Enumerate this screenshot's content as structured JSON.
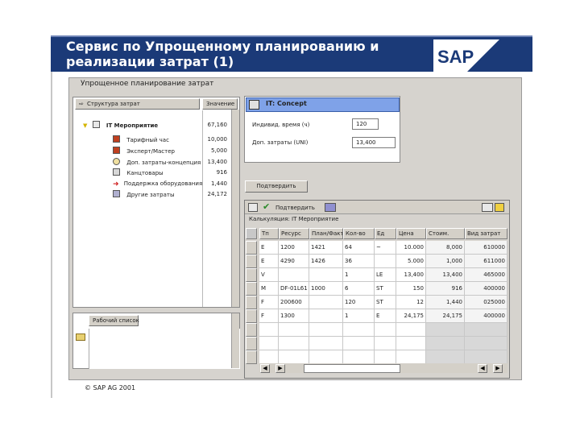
{
  "slide": {
    "title_line1": "Сервис по Упрощенному планированию и",
    "title_line2": "реализации затрат   (1)",
    "footer": "SAP AG 2001",
    "logo_text": "SAP"
  },
  "window": {
    "title": "Упрощенное планирование затрат"
  },
  "left_panel": {
    "structure_header": "Структура затрат",
    "value_header": "Значение",
    "root": {
      "label": "IT Мероприятие",
      "value": "67,160"
    },
    "items": [
      {
        "icon": "rate-icon",
        "label": "Тарифный час",
        "value": "10,000"
      },
      {
        "icon": "role-icon",
        "label": "Эксперт/Мастер",
        "value": "5,000"
      },
      {
        "icon": "extra-cost-icon",
        "label": "Доп. затраты-концепция",
        "value": "13,400"
      },
      {
        "icon": "office-icon",
        "label": "Канцтовары",
        "value": "916"
      },
      {
        "icon": "equipment-icon",
        "label": "Поддержка оборудования",
        "value": "1,440"
      },
      {
        "icon": "other-cost-icon",
        "label": "Другие затраты",
        "value": "24,172"
      }
    ]
  },
  "worklist": {
    "button": "Рабочий список"
  },
  "detail": {
    "title": "IT: Concept",
    "fields": [
      {
        "label": "Индивид. время (ч)",
        "value": "120"
      },
      {
        "label": "Доп. затраты (UNI)",
        "value": "13,400"
      }
    ],
    "confirm_button": "Подтвердить"
  },
  "grid": {
    "toolbar_label": "Подтвердить",
    "caption": "Калькуляция: IT Мероприятие",
    "columns": [
      "Тп",
      "Ресурс",
      "План/Факт",
      "Кол-во",
      "Ед",
      "Цена",
      "Стоим.",
      "Вид затрат"
    ],
    "rows": [
      [
        "E",
        "1200",
        "1421",
        "64",
        "~",
        "10.000",
        "8,000",
        "610000"
      ],
      [
        "E",
        "4290",
        "1426",
        "36",
        "",
        "5.000",
        "1,000",
        "611000"
      ],
      [
        "V",
        "",
        "",
        "1",
        "LE",
        "13,400",
        "13,400",
        "465000"
      ],
      [
        "M",
        "DF-01L61",
        "1000",
        "6",
        "ST",
        "150",
        "916",
        "400000"
      ],
      [
        "F",
        "200600",
        "",
        "120",
        "ST",
        "12",
        "1,440",
        "025000"
      ],
      [
        "F",
        "1300",
        "",
        "1",
        "E",
        "24,175",
        "24,175",
        "400000"
      ]
    ]
  }
}
